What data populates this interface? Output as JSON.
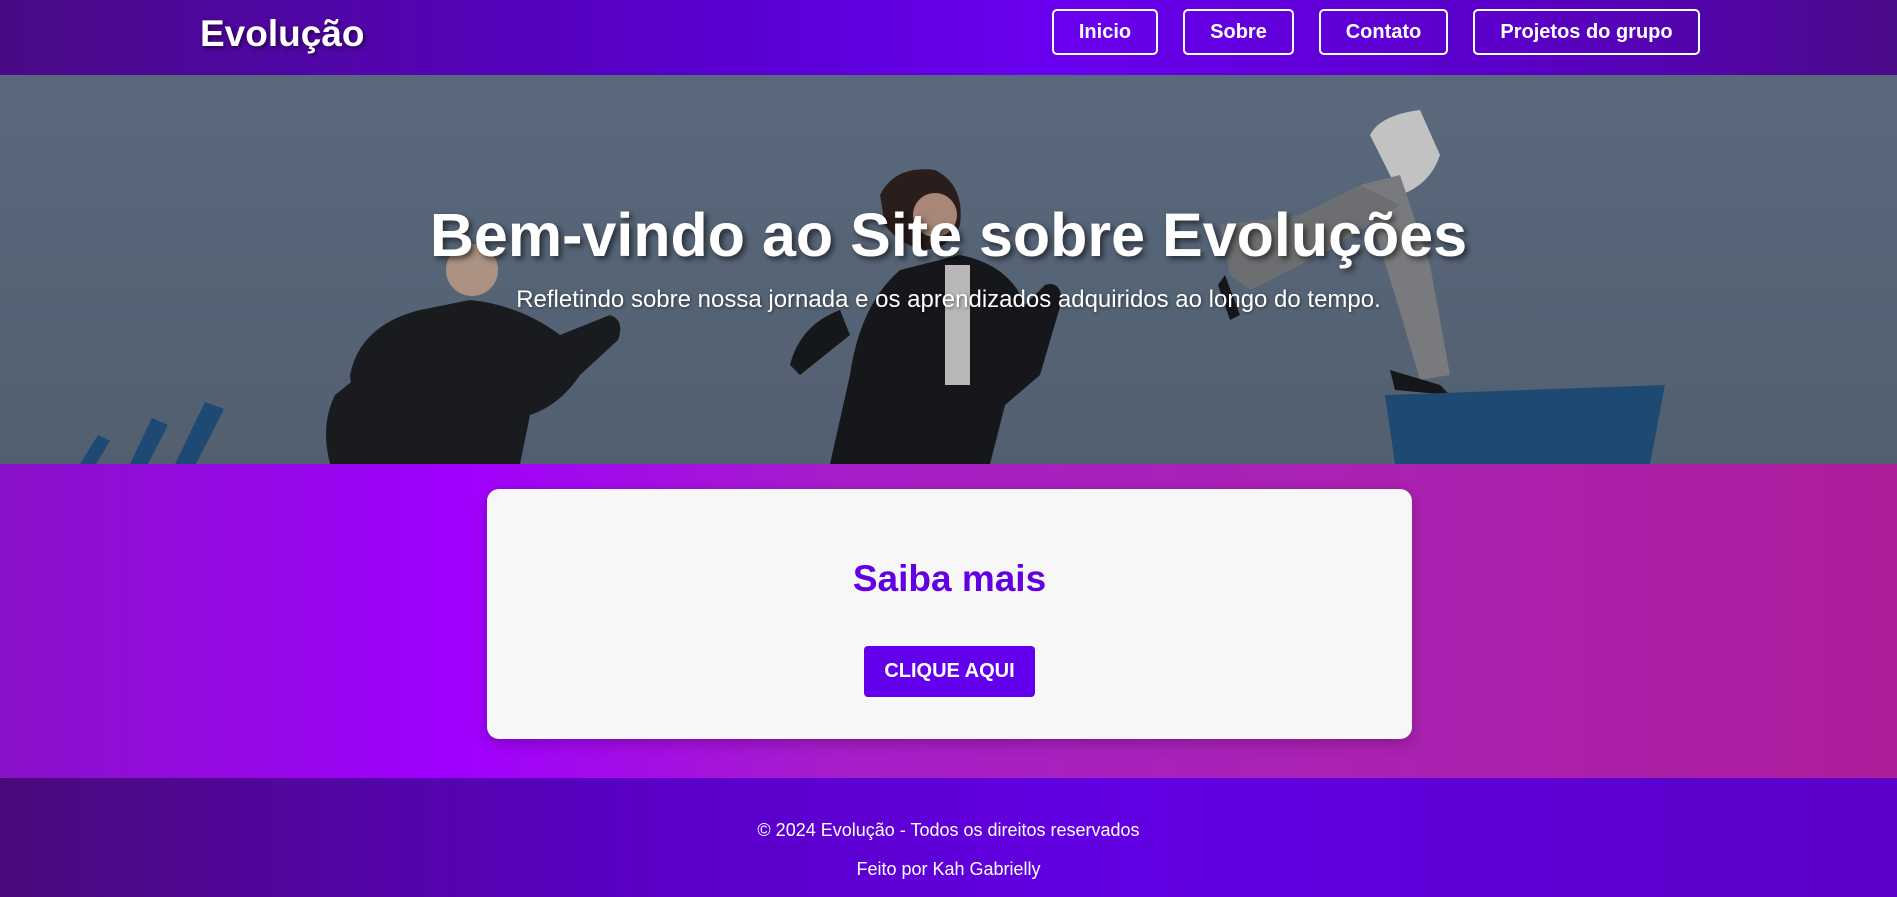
{
  "header": {
    "logo": "Evolução",
    "nav": [
      {
        "label": "Inicio"
      },
      {
        "label": "Sobre"
      },
      {
        "label": "Contato"
      },
      {
        "label": "Projetos do grupo"
      }
    ]
  },
  "hero": {
    "title": "Bem-vindo ao Site sobre Evoluções",
    "subtitle": "Refletindo sobre nossa jornada e os aprendizados adquiridos ao longo do tempo."
  },
  "card": {
    "title": "Saiba mais",
    "button_label": "CLIQUE AQUI"
  },
  "footer": {
    "copyright": "© 2024 Evolução - Todos os direitos reservados",
    "credit": "Feito por Kah Gabrielly"
  },
  "colors": {
    "accent": "#6200ee",
    "header_purple": "#5a00d4",
    "hero_bg": "#5f6e7d",
    "card_bg": "#f7f7f7"
  }
}
